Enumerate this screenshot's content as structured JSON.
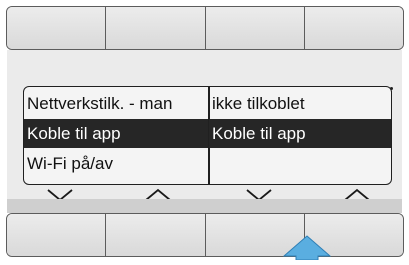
{
  "menu": {
    "left_items": [
      {
        "label": "Nettverkstilk. - man",
        "selected": false
      },
      {
        "label": "Koble til app",
        "selected": true
      },
      {
        "label": "Wi-Fi på/av",
        "selected": false
      }
    ],
    "right_items": [
      {
        "label": "ikke tilkoblet",
        "selected": false
      },
      {
        "label": "Koble til app",
        "selected": true
      },
      {
        "label": "",
        "selected": false
      }
    ]
  },
  "navigation": {
    "left_down": "chevron-down-icon",
    "left_up": "chevron-up-icon",
    "right_down": "chevron-down-icon",
    "right_up": "chevron-up-icon"
  },
  "softkeys": {
    "top_count": 4,
    "bottom_count": 4,
    "highlighted_bottom_key": 3
  },
  "colors": {
    "selection_bg": "#262626",
    "selection_fg": "#ffffff",
    "indicator_arrow": "#5aaee0",
    "screen_bg": "#ebebeb"
  }
}
